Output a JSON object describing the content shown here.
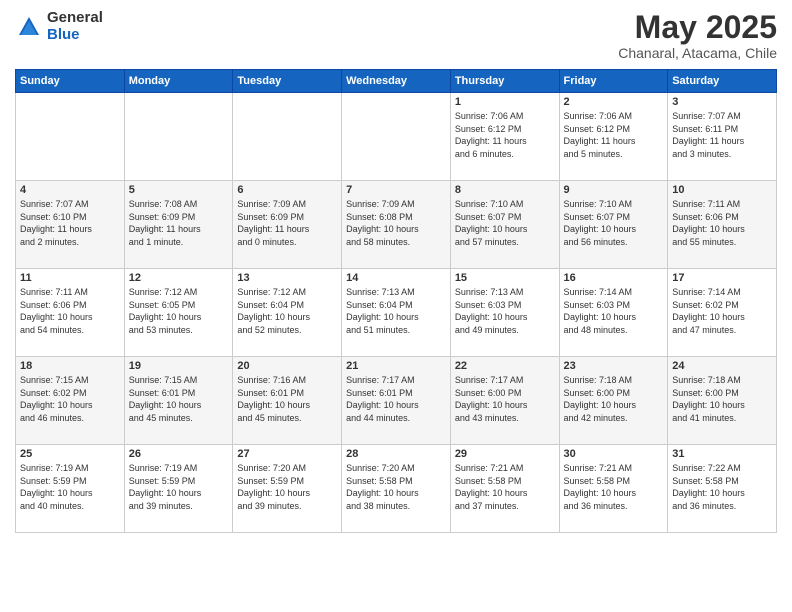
{
  "logo": {
    "general": "General",
    "blue": "Blue"
  },
  "title": "May 2025",
  "location": "Chanaral, Atacama, Chile",
  "days_of_week": [
    "Sunday",
    "Monday",
    "Tuesday",
    "Wednesday",
    "Thursday",
    "Friday",
    "Saturday"
  ],
  "weeks": [
    [
      {
        "day": "",
        "info": ""
      },
      {
        "day": "",
        "info": ""
      },
      {
        "day": "",
        "info": ""
      },
      {
        "day": "",
        "info": ""
      },
      {
        "day": "1",
        "info": "Sunrise: 7:06 AM\nSunset: 6:12 PM\nDaylight: 11 hours\nand 6 minutes."
      },
      {
        "day": "2",
        "info": "Sunrise: 7:06 AM\nSunset: 6:12 PM\nDaylight: 11 hours\nand 5 minutes."
      },
      {
        "day": "3",
        "info": "Sunrise: 7:07 AM\nSunset: 6:11 PM\nDaylight: 11 hours\nand 3 minutes."
      }
    ],
    [
      {
        "day": "4",
        "info": "Sunrise: 7:07 AM\nSunset: 6:10 PM\nDaylight: 11 hours\nand 2 minutes."
      },
      {
        "day": "5",
        "info": "Sunrise: 7:08 AM\nSunset: 6:09 PM\nDaylight: 11 hours\nand 1 minute."
      },
      {
        "day": "6",
        "info": "Sunrise: 7:09 AM\nSunset: 6:09 PM\nDaylight: 11 hours\nand 0 minutes."
      },
      {
        "day": "7",
        "info": "Sunrise: 7:09 AM\nSunset: 6:08 PM\nDaylight: 10 hours\nand 58 minutes."
      },
      {
        "day": "8",
        "info": "Sunrise: 7:10 AM\nSunset: 6:07 PM\nDaylight: 10 hours\nand 57 minutes."
      },
      {
        "day": "9",
        "info": "Sunrise: 7:10 AM\nSunset: 6:07 PM\nDaylight: 10 hours\nand 56 minutes."
      },
      {
        "day": "10",
        "info": "Sunrise: 7:11 AM\nSunset: 6:06 PM\nDaylight: 10 hours\nand 55 minutes."
      }
    ],
    [
      {
        "day": "11",
        "info": "Sunrise: 7:11 AM\nSunset: 6:06 PM\nDaylight: 10 hours\nand 54 minutes."
      },
      {
        "day": "12",
        "info": "Sunrise: 7:12 AM\nSunset: 6:05 PM\nDaylight: 10 hours\nand 53 minutes."
      },
      {
        "day": "13",
        "info": "Sunrise: 7:12 AM\nSunset: 6:04 PM\nDaylight: 10 hours\nand 52 minutes."
      },
      {
        "day": "14",
        "info": "Sunrise: 7:13 AM\nSunset: 6:04 PM\nDaylight: 10 hours\nand 51 minutes."
      },
      {
        "day": "15",
        "info": "Sunrise: 7:13 AM\nSunset: 6:03 PM\nDaylight: 10 hours\nand 49 minutes."
      },
      {
        "day": "16",
        "info": "Sunrise: 7:14 AM\nSunset: 6:03 PM\nDaylight: 10 hours\nand 48 minutes."
      },
      {
        "day": "17",
        "info": "Sunrise: 7:14 AM\nSunset: 6:02 PM\nDaylight: 10 hours\nand 47 minutes."
      }
    ],
    [
      {
        "day": "18",
        "info": "Sunrise: 7:15 AM\nSunset: 6:02 PM\nDaylight: 10 hours\nand 46 minutes."
      },
      {
        "day": "19",
        "info": "Sunrise: 7:15 AM\nSunset: 6:01 PM\nDaylight: 10 hours\nand 45 minutes."
      },
      {
        "day": "20",
        "info": "Sunrise: 7:16 AM\nSunset: 6:01 PM\nDaylight: 10 hours\nand 45 minutes."
      },
      {
        "day": "21",
        "info": "Sunrise: 7:17 AM\nSunset: 6:01 PM\nDaylight: 10 hours\nand 44 minutes."
      },
      {
        "day": "22",
        "info": "Sunrise: 7:17 AM\nSunset: 6:00 PM\nDaylight: 10 hours\nand 43 minutes."
      },
      {
        "day": "23",
        "info": "Sunrise: 7:18 AM\nSunset: 6:00 PM\nDaylight: 10 hours\nand 42 minutes."
      },
      {
        "day": "24",
        "info": "Sunrise: 7:18 AM\nSunset: 6:00 PM\nDaylight: 10 hours\nand 41 minutes."
      }
    ],
    [
      {
        "day": "25",
        "info": "Sunrise: 7:19 AM\nSunset: 5:59 PM\nDaylight: 10 hours\nand 40 minutes."
      },
      {
        "day": "26",
        "info": "Sunrise: 7:19 AM\nSunset: 5:59 PM\nDaylight: 10 hours\nand 39 minutes."
      },
      {
        "day": "27",
        "info": "Sunrise: 7:20 AM\nSunset: 5:59 PM\nDaylight: 10 hours\nand 39 minutes."
      },
      {
        "day": "28",
        "info": "Sunrise: 7:20 AM\nSunset: 5:58 PM\nDaylight: 10 hours\nand 38 minutes."
      },
      {
        "day": "29",
        "info": "Sunrise: 7:21 AM\nSunset: 5:58 PM\nDaylight: 10 hours\nand 37 minutes."
      },
      {
        "day": "30",
        "info": "Sunrise: 7:21 AM\nSunset: 5:58 PM\nDaylight: 10 hours\nand 36 minutes."
      },
      {
        "day": "31",
        "info": "Sunrise: 7:22 AM\nSunset: 5:58 PM\nDaylight: 10 hours\nand 36 minutes."
      }
    ]
  ]
}
